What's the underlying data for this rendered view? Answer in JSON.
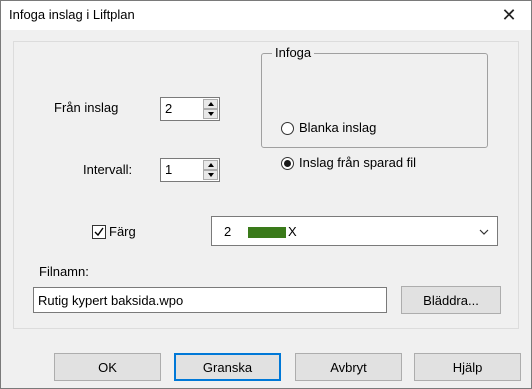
{
  "window": {
    "title": "Infoga inslag i Liftplan",
    "close_glyph": "✕"
  },
  "from_pick": {
    "label": "Från inslag",
    "value": "2"
  },
  "interval": {
    "label": "Intervall:",
    "value": "1"
  },
  "insert_group": {
    "title": "Infoga",
    "options": [
      {
        "label": "Blanka inslag",
        "checked": false
      },
      {
        "label": "Inslag från sparad fil",
        "checked": true
      }
    ]
  },
  "color": {
    "label": "Färg",
    "checked": true,
    "selected_number": "2",
    "selected_text": "X",
    "swatch_color": "#3a7a1a"
  },
  "filename": {
    "label": "Filnamn:",
    "value": "Rutig kypert baksida.wpo",
    "browse_label": "Bläddra..."
  },
  "buttons": {
    "ok": "OK",
    "preview": "Granska",
    "cancel": "Avbryt",
    "help": "Hjälp"
  }
}
